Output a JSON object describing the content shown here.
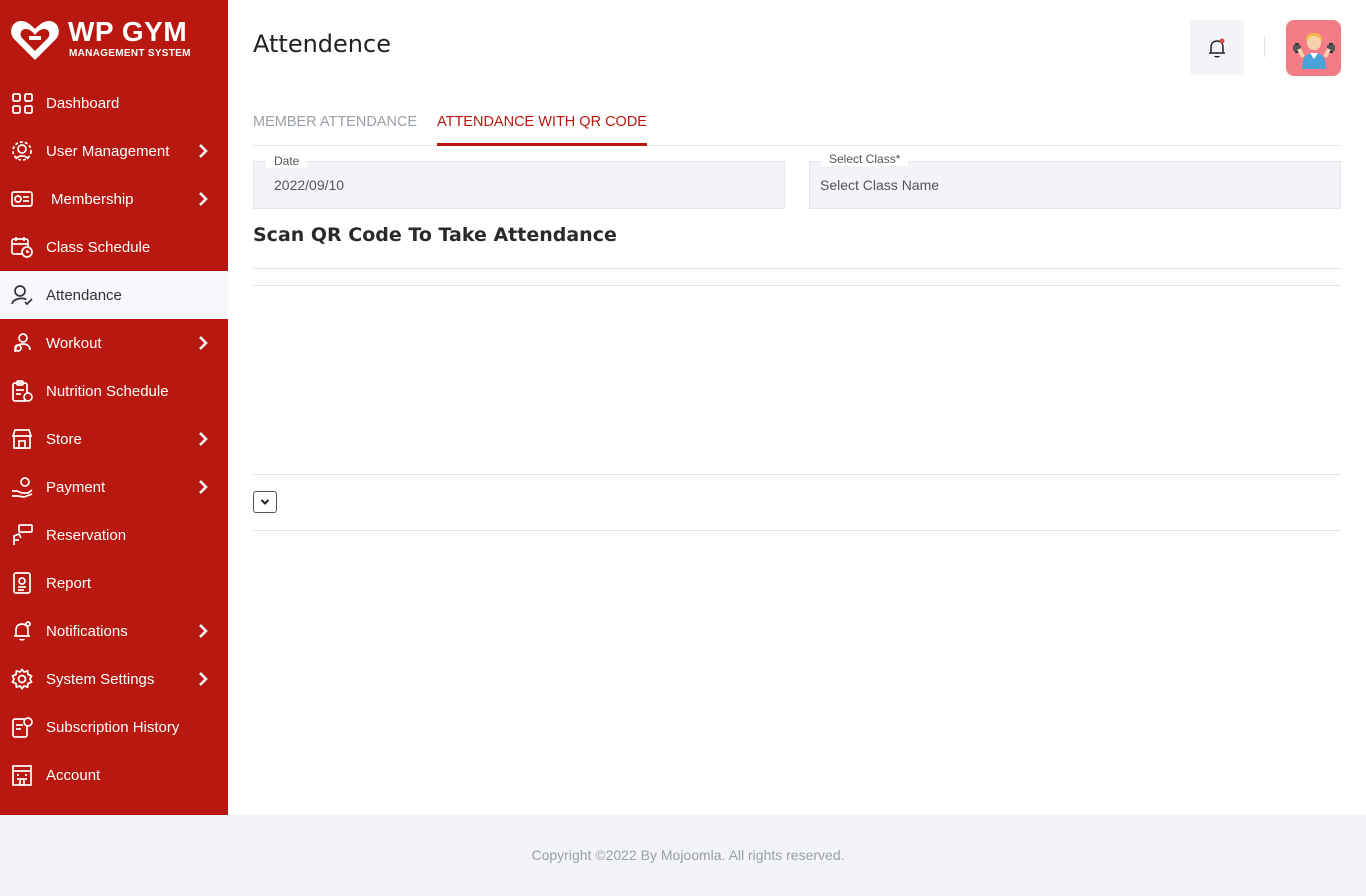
{
  "brand": {
    "title": "WP GYM",
    "subtitle": "MANAGEMENT SYSTEM"
  },
  "colors": {
    "sidebar": "#b8180f",
    "accent": "#b8180f",
    "active_bg": "#f7f8fc",
    "avatar_bg": "#f47c86"
  },
  "sidebar": {
    "items": [
      {
        "label": "Dashboard",
        "icon": "dashboard-grid-icon",
        "has_submenu": false
      },
      {
        "label": "User Management",
        "icon": "users-gear-icon",
        "has_submenu": true
      },
      {
        "label": "Membership",
        "icon": "membership-card-icon",
        "has_submenu": true
      },
      {
        "label": "Class Schedule",
        "icon": "calendar-clock-icon",
        "has_submenu": false
      },
      {
        "label": "Attendance",
        "icon": "user-check-icon",
        "has_submenu": false,
        "active": true
      },
      {
        "label": "Workout",
        "icon": "workout-icon",
        "has_submenu": true
      },
      {
        "label": "Nutrition Schedule",
        "icon": "nutrition-clipboard-icon",
        "has_submenu": false
      },
      {
        "label": "Store",
        "icon": "store-icon",
        "has_submenu": true
      },
      {
        "label": "Payment",
        "icon": "payment-hand-icon",
        "has_submenu": true
      },
      {
        "label": "Reservation",
        "icon": "reservation-icon",
        "has_submenu": false
      },
      {
        "label": "Report",
        "icon": "report-icon",
        "has_submenu": false
      },
      {
        "label": "Notifications",
        "icon": "bell-icon",
        "has_submenu": true
      },
      {
        "label": "System Settings",
        "icon": "gear-icon",
        "has_submenu": true
      },
      {
        "label": "Subscription History",
        "icon": "subscription-history-icon",
        "has_submenu": false
      },
      {
        "label": "Account",
        "icon": "account-building-icon",
        "has_submenu": false
      }
    ]
  },
  "header": {
    "title": "Attendence"
  },
  "tabs": [
    {
      "label": "MEMBER ATTENDANCE",
      "active": false
    },
    {
      "label": "ATTENDANCE WITH QR CODE",
      "active": true
    }
  ],
  "form": {
    "date": {
      "label": "Date",
      "value": "2022/09/10"
    },
    "class": {
      "label": "Select Class*",
      "value": "Select Class Name"
    }
  },
  "scan": {
    "title": "Scan QR Code To Take Attendance"
  },
  "footer": {
    "text": "Copyright ©2022 By Mojoomla. All rights reserved."
  }
}
